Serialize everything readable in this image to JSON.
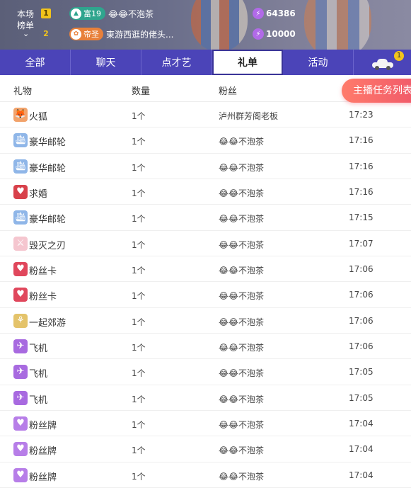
{
  "ranking": {
    "label": "本场榜单",
    "label_line1": "本场",
    "label_line2": "榜单",
    "expand_icon": "chevron-down-icon",
    "entries": [
      {
        "rank": "1",
        "badge_text": "富19",
        "badge_icon": "triangle-emblem-icon",
        "badge_color": "#2fa58e",
        "name": "😂😂不泡茶",
        "score": "64386"
      },
      {
        "rank": "2",
        "badge_text": "帝圣",
        "badge_icon": "crest-emblem-icon",
        "badge_color": "#e8803a",
        "name": "東游西逛的佬头...",
        "score": "10000"
      }
    ]
  },
  "tabs": [
    {
      "label": "全部",
      "active": false
    },
    {
      "label": "聊天",
      "active": false
    },
    {
      "label": "点才艺",
      "active": false
    },
    {
      "label": "礼单",
      "active": true
    },
    {
      "label": "活动",
      "active": false
    }
  ],
  "car_tab": {
    "icon": "car-icon",
    "badge_count": "1"
  },
  "table": {
    "headers": {
      "gift": "礼物",
      "quantity": "数量",
      "fan": "粉丝"
    },
    "task_button": "主播任务列表",
    "rows": [
      {
        "gift": "火狐",
        "icon": "fox-icon",
        "quantity": "1个",
        "fan": "泸州群芳阁老板",
        "time": "17:23"
      },
      {
        "gift": "豪华邮轮",
        "icon": "cruise-ship-icon",
        "quantity": "1个",
        "fan": "😂😂不泡茶",
        "time": "17:16"
      },
      {
        "gift": "豪华邮轮",
        "icon": "cruise-ship-icon",
        "quantity": "1个",
        "fan": "😂😂不泡茶",
        "time": "17:16"
      },
      {
        "gift": "求婚",
        "icon": "proposal-icon",
        "quantity": "1个",
        "fan": "😂😂不泡茶",
        "time": "17:16"
      },
      {
        "gift": "豪华邮轮",
        "icon": "cruise-ship-icon",
        "quantity": "1个",
        "fan": "😂😂不泡茶",
        "time": "17:15"
      },
      {
        "gift": "毁灭之刃",
        "icon": "blade-icon",
        "quantity": "1个",
        "fan": "😂😂不泡茶",
        "time": "17:07"
      },
      {
        "gift": "粉丝卡",
        "icon": "fan-card-icon",
        "quantity": "1个",
        "fan": "😂😂不泡茶",
        "time": "17:06"
      },
      {
        "gift": "粉丝卡",
        "icon": "fan-card-icon",
        "quantity": "1个",
        "fan": "😂😂不泡茶",
        "time": "17:06"
      },
      {
        "gift": "一起郊游",
        "icon": "outing-icon",
        "quantity": "1个",
        "fan": "😂😂不泡茶",
        "time": "17:06"
      },
      {
        "gift": "飞机",
        "icon": "airplane-icon",
        "quantity": "1个",
        "fan": "😂😂不泡茶",
        "time": "17:06"
      },
      {
        "gift": "飞机",
        "icon": "airplane-icon",
        "quantity": "1个",
        "fan": "😂😂不泡茶",
        "time": "17:05"
      },
      {
        "gift": "飞机",
        "icon": "airplane-icon",
        "quantity": "1个",
        "fan": "😂😂不泡茶",
        "time": "17:05"
      },
      {
        "gift": "粉丝牌",
        "icon": "fan-badge-icon",
        "quantity": "1个",
        "fan": "😂😂不泡茶",
        "time": "17:04"
      },
      {
        "gift": "粉丝牌",
        "icon": "fan-badge-icon",
        "quantity": "1个",
        "fan": "😂😂不泡茶",
        "time": "17:04"
      },
      {
        "gift": "粉丝牌",
        "icon": "fan-badge-icon",
        "quantity": "1个",
        "fan": "😂😂不泡茶",
        "time": "17:04"
      }
    ]
  }
}
